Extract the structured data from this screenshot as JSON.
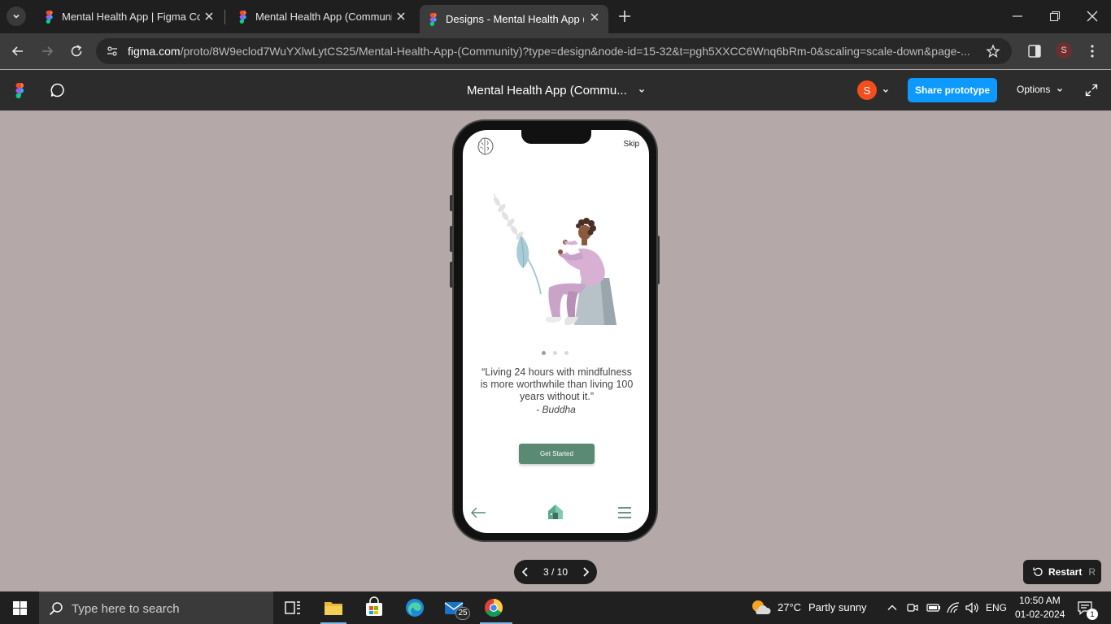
{
  "browser": {
    "tabs": [
      {
        "title": "Mental Health App | Figma Com",
        "active": false
      },
      {
        "title": "Mental Health App (Community",
        "active": false
      },
      {
        "title": "Designs - Mental Health App (C",
        "active": true
      }
    ],
    "url_host": "figma.com",
    "url_path": "/proto/8W9eclod7WuYXlwLytCS25/Mental-Health-App-(Community)?type=design&node-id=15-32&t=pgh5XXCC6Wnq6bRm-0&scaling=scale-down&page-...",
    "profile_initial": "S"
  },
  "figma": {
    "file_title": "Mental Health App (Commu...",
    "avatar_initial": "S",
    "share_label": "Share prototype",
    "options_label": "Options"
  },
  "prototype": {
    "skip_label": "Skip",
    "quote": "“Living 24 hours with mindfulness is more worthwhile than living 100 years without it.”",
    "author": "- Buddha",
    "cta_label": "Get Started",
    "dots_total": 3,
    "dots_active": 1
  },
  "pager": {
    "label": "3 / 10"
  },
  "restart": {
    "label": "Restart",
    "shortcut": "R"
  },
  "taskbar": {
    "search_placeholder": "Type here to search",
    "mail_badge": "25",
    "weather_temp": "27°C",
    "weather_text": "Partly sunny",
    "language": "ENG",
    "time": "10:50 AM",
    "date": "01-02-2024",
    "notification_count": "1"
  },
  "colors": {
    "canvas": "#b5a8a8",
    "brand_green": "#5a8a73",
    "share_blue": "#0d99ff",
    "figma_orange": "#f24e1e"
  }
}
